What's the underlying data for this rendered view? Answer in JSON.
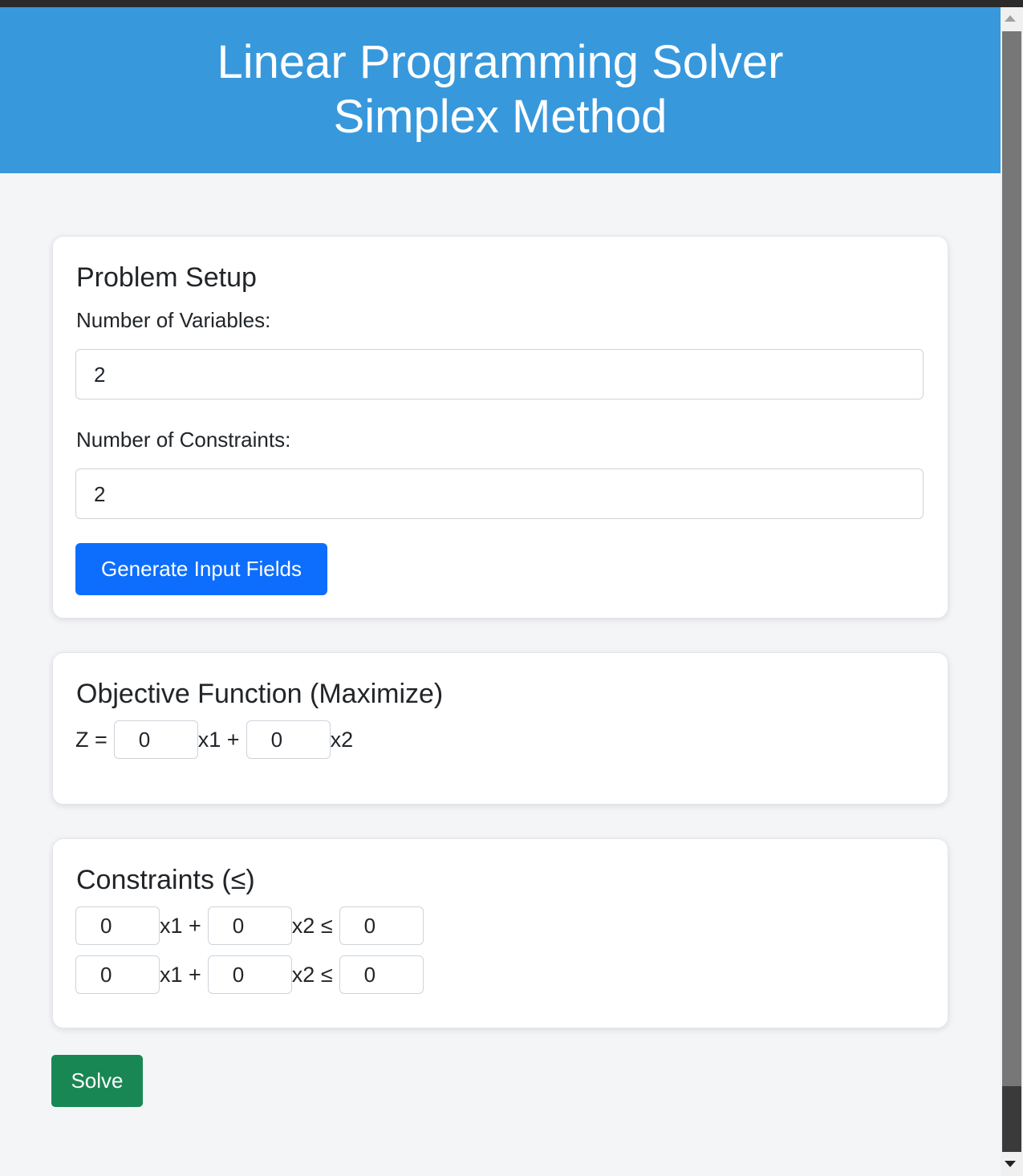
{
  "header": {
    "title_line1": "Linear Programming Solver",
    "title_line2": "Simplex Method"
  },
  "setup": {
    "title": "Problem Setup",
    "variables_label": "Number of Variables:",
    "variables_value": "2",
    "constraints_label": "Number of Constraints:",
    "constraints_value": "2",
    "generate_button": "Generate Input Fields"
  },
  "objective": {
    "title": "Objective Function (Maximize)",
    "prefix": "Z =",
    "coefficients": [
      "0",
      "0"
    ],
    "terms": [
      "x1 +",
      "x2"
    ]
  },
  "constraints": {
    "title": "Constraints (≤)",
    "rows": [
      {
        "coefficients": [
          "0",
          "0"
        ],
        "rhs": "0",
        "terms": [
          "x1 +",
          "x2 ≤"
        ]
      },
      {
        "coefficients": [
          "0",
          "0"
        ],
        "rhs": "0",
        "terms": [
          "x1 +",
          "x2 ≤"
        ]
      }
    ]
  },
  "solve_button": "Solve"
}
